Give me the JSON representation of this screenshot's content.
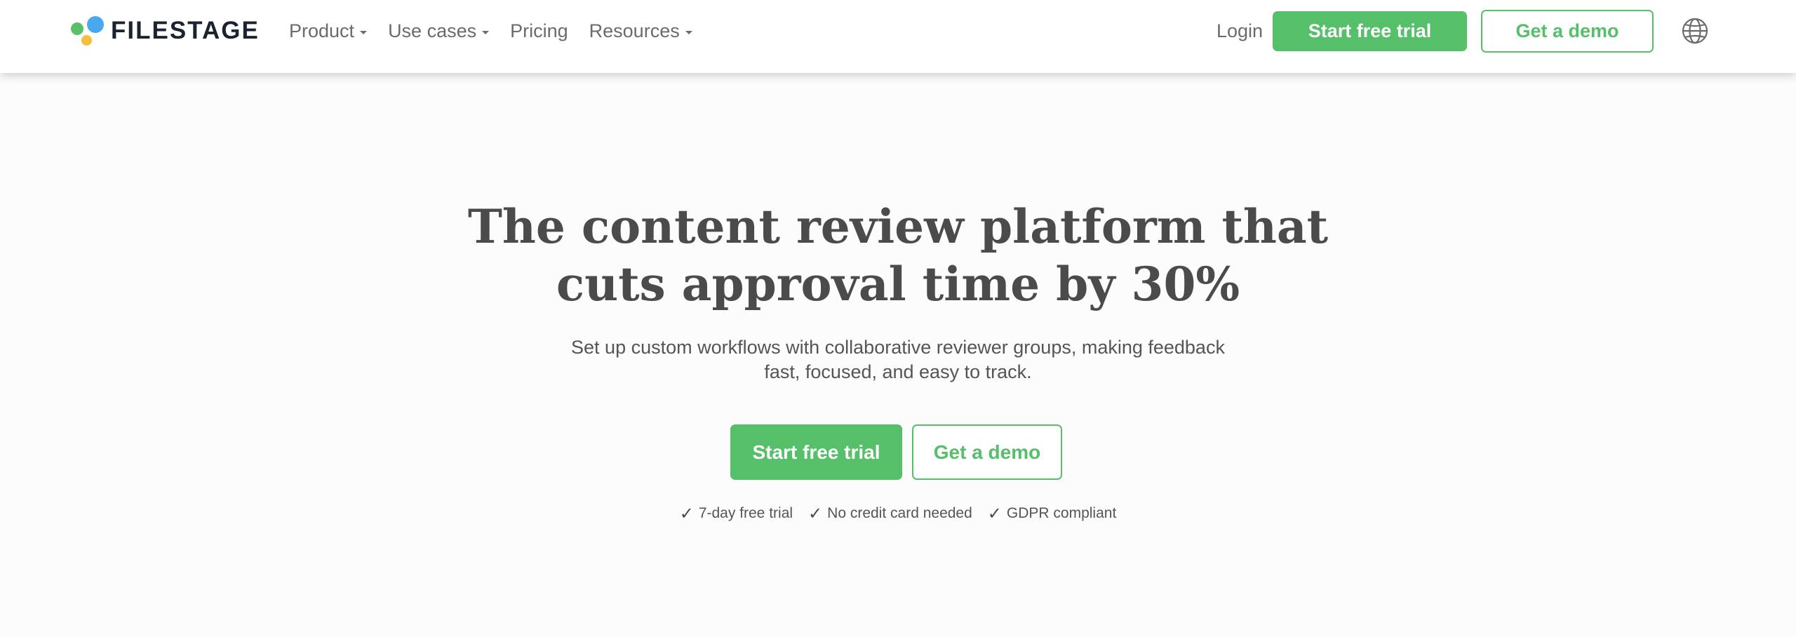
{
  "brand": {
    "name": "FILESTAGE",
    "logo_icon": "filestage-dots-logo",
    "colors": {
      "green": "#55bf6a",
      "blue": "#4aa8f0",
      "yellow": "#f3c03e",
      "dark": "#1c2330"
    }
  },
  "nav": {
    "items": [
      {
        "label": "Product",
        "has_dropdown": true
      },
      {
        "label": "Use cases",
        "has_dropdown": true
      },
      {
        "label": "Pricing",
        "has_dropdown": false
      },
      {
        "label": "Resources",
        "has_dropdown": true
      }
    ],
    "login_label": "Login",
    "trial_label": "Start free trial",
    "demo_label": "Get a demo",
    "language_icon": "globe-icon"
  },
  "hero": {
    "title_line1": "The content review platform that",
    "title_line2": "cuts approval time by 30%",
    "subtitle_line1": "Set up custom workflows with collaborative reviewer groups, making feedback",
    "subtitle_line2": "fast, focused, and easy to track.",
    "trial_label": "Start free trial",
    "demo_label": "Get a demo",
    "checks": [
      {
        "icon": "checkmark-icon",
        "label": "7-day free trial"
      },
      {
        "icon": "checkmark-icon",
        "label": "No credit card needed"
      },
      {
        "icon": "checkmark-icon",
        "label": "GDPR compliant"
      }
    ]
  }
}
